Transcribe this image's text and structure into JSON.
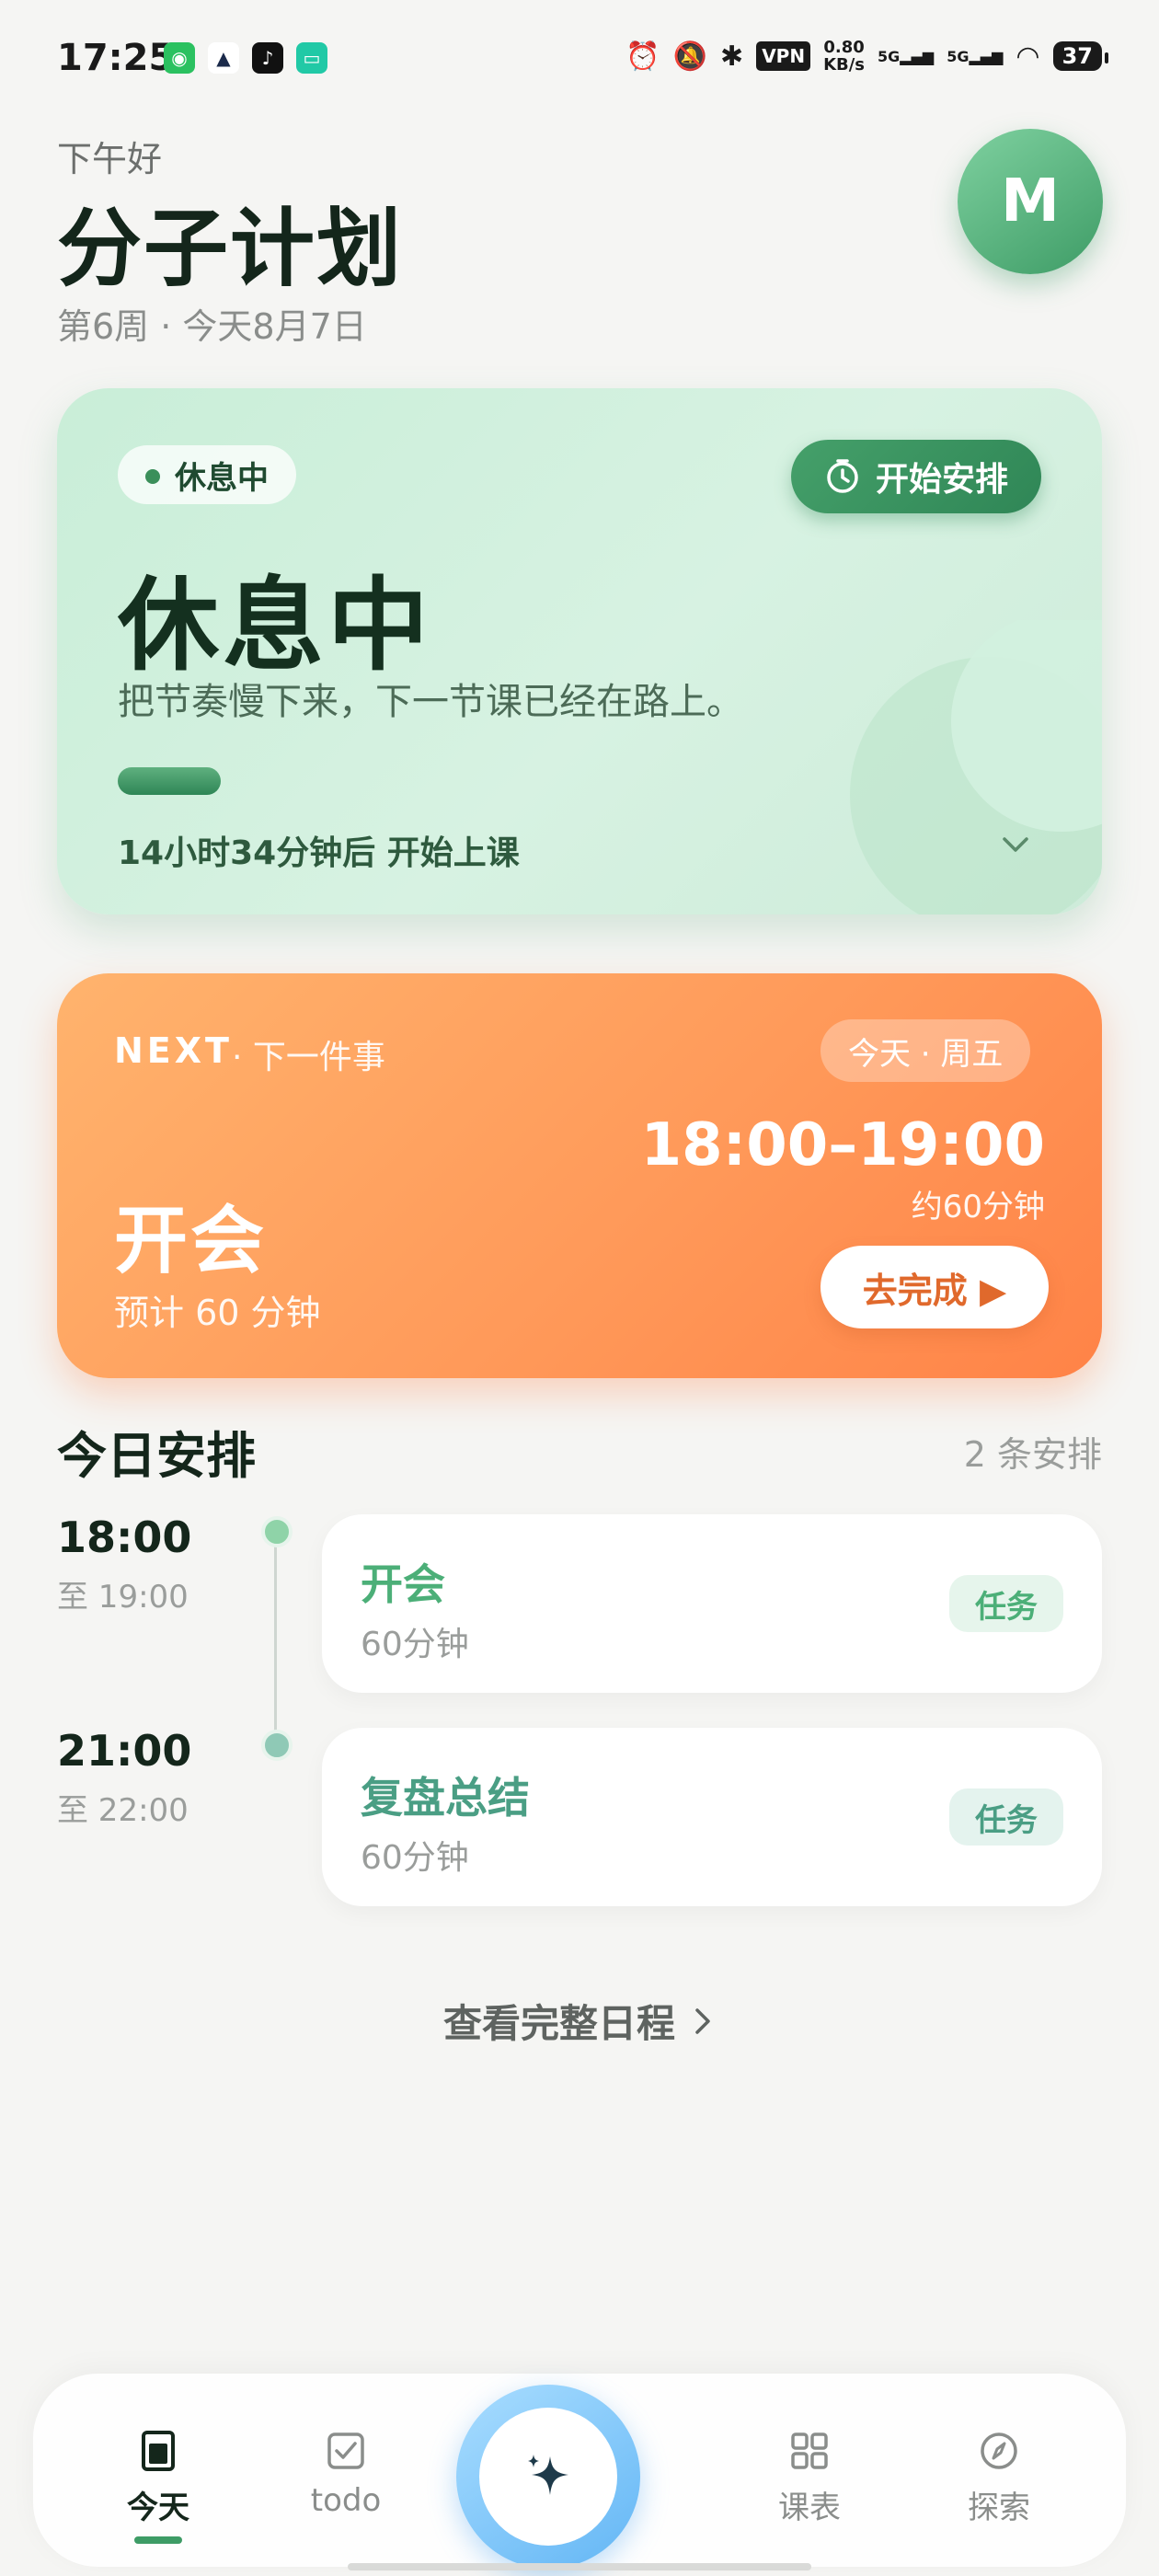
{
  "status_bar": {
    "time": "17:25",
    "app_icons": [
      "wechat-icon",
      "cat-icon",
      "tiktok-icon",
      "message-icon"
    ],
    "vpn": "VPN",
    "speed_value": "0.80",
    "speed_unit": "KB/s",
    "signal_label_1": "5G",
    "signal_label_2": "5G",
    "battery": "37"
  },
  "header": {
    "greeting": "下午好",
    "title": "分子计划",
    "week_line": "第6周 · 今天8月7日",
    "avatar_letter": "M"
  },
  "rest_card": {
    "status_pill": "休息中",
    "start_button": "开始安排",
    "title": "休息中",
    "subtitle": "把节奏慢下来，下一节课已经在路上。",
    "countdown": "14小时34分钟后 开始上课",
    "progress": 0.05
  },
  "next_card": {
    "label": "NEXT",
    "label_sub": "· 下一件事",
    "day": "今天 · 周五",
    "time_range": "18:00–19:00",
    "duration_approx": "约60分钟",
    "event_name": "开会",
    "estimate": "预计 60 分钟",
    "complete_button": "去完成 ▶"
  },
  "schedule": {
    "title": "今日安排",
    "count": "2 条安排",
    "items": [
      {
        "time": "18:00",
        "until": "至 19:00",
        "name": "开会",
        "duration": "60分钟",
        "badge": "任务",
        "accent": "#4caf78"
      },
      {
        "time": "21:00",
        "until": "至 22:00",
        "name": "复盘总结",
        "duration": "60分钟",
        "badge": "任务",
        "accent": "#4a9e84"
      }
    ],
    "view_all": "查看完整日程"
  },
  "bottom_nav": {
    "items": [
      {
        "label": "今天",
        "icon": "today-icon",
        "active": true
      },
      {
        "label": "todo",
        "icon": "checkbox-icon",
        "active": false
      },
      {
        "label": "课表",
        "icon": "grid-icon",
        "active": false
      },
      {
        "label": "探索",
        "icon": "compass-icon",
        "active": false
      }
    ],
    "fab_icon": "sparkle-icon"
  },
  "colors": {
    "primary_green": "#3e9c66",
    "orange": "#ff9a5a",
    "fab_blue": "#63b6f5"
  }
}
